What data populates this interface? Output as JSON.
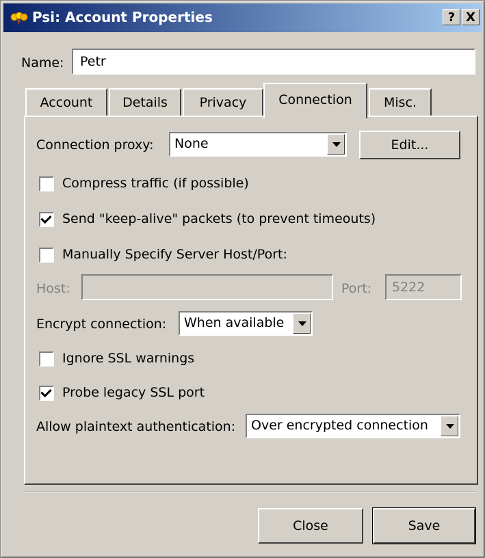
{
  "window": {
    "title": "Psi: Account Properties",
    "help_button": "?",
    "close_button": "X"
  },
  "name": {
    "label": "Name:",
    "value": "Petr"
  },
  "tabs": [
    {
      "label": "Account",
      "active": false
    },
    {
      "label": "Details",
      "active": false
    },
    {
      "label": "Privacy",
      "active": false
    },
    {
      "label": "Connection",
      "active": true
    },
    {
      "label": "Misc.",
      "active": false
    }
  ],
  "connection": {
    "proxy_label": "Connection proxy:",
    "proxy_value": "None",
    "edit_button": "Edit...",
    "compress_label": "Compress traffic (if possible)",
    "compress_checked": false,
    "keepalive_label": "Send \"keep-alive\" packets (to prevent timeouts)",
    "keepalive_checked": true,
    "manual_label": "Manually Specify Server Host/Port:",
    "manual_checked": false,
    "host_label": "Host:",
    "host_value": "",
    "port_label": "Port:",
    "port_value": "5222",
    "encrypt_label": "Encrypt connection:",
    "encrypt_value": "When available",
    "ignore_ssl_label": "Ignore SSL warnings",
    "ignore_ssl_checked": false,
    "probe_ssl_label": "Probe legacy SSL port",
    "probe_ssl_checked": true,
    "plaintext_label": "Allow plaintext authentication:",
    "plaintext_value": "Over encrypted connection"
  },
  "footer": {
    "close_button": "Close",
    "save_button": "Save"
  }
}
